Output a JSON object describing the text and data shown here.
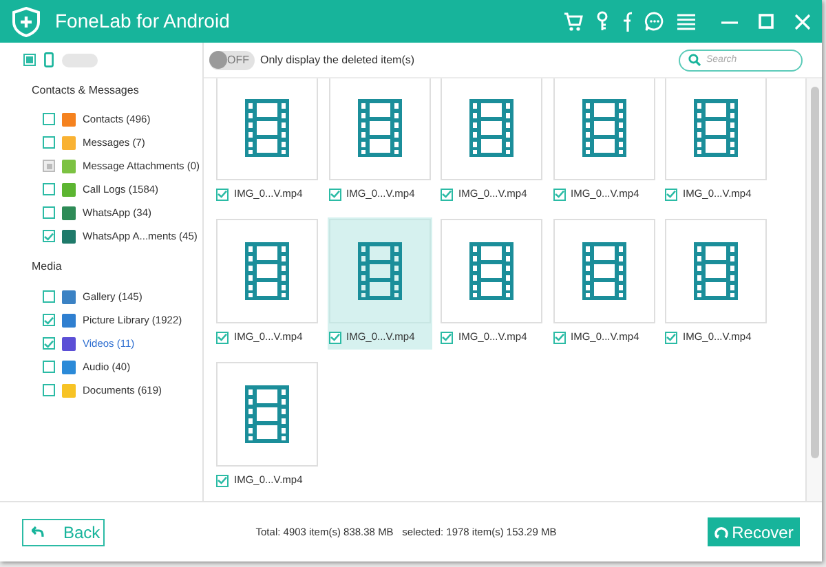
{
  "window": {
    "title": "FoneLab for Android"
  },
  "device": {
    "partially_checked": true
  },
  "filter": {
    "toggle_label": "OFF",
    "on": false,
    "label": "Only display the deleted item(s)"
  },
  "search": {
    "placeholder": "Search"
  },
  "sidebar": {
    "sections": [
      {
        "title": "Contacts & Messages",
        "items": [
          {
            "label": "Contacts (496)",
            "checked": false,
            "disabled": false,
            "selected": false,
            "color": "#f5821f"
          },
          {
            "label": "Messages (7)",
            "checked": false,
            "disabled": false,
            "selected": false,
            "color": "#f9b233"
          },
          {
            "label": "Message Attachments (0)",
            "checked": false,
            "disabled": true,
            "selected": false,
            "color": "#7cc242"
          },
          {
            "label": "Call Logs (1584)",
            "checked": false,
            "disabled": false,
            "selected": false,
            "color": "#5cb531"
          },
          {
            "label": "WhatsApp (34)",
            "checked": false,
            "disabled": false,
            "selected": false,
            "color": "#2e8b57"
          },
          {
            "label": "WhatsApp A...ments (45)",
            "checked": true,
            "disabled": false,
            "selected": false,
            "color": "#1f7a6a"
          }
        ]
      },
      {
        "title": "Media",
        "items": [
          {
            "label": "Gallery (145)",
            "checked": false,
            "disabled": false,
            "selected": false,
            "color": "#3b82c4"
          },
          {
            "label": "Picture Library (1922)",
            "checked": true,
            "disabled": false,
            "selected": false,
            "color": "#2f7fd0"
          },
          {
            "label": "Videos (11)",
            "checked": true,
            "disabled": false,
            "selected": true,
            "color": "#5b4fd6"
          },
          {
            "label": "Audio (40)",
            "checked": false,
            "disabled": false,
            "selected": false,
            "color": "#2b8ad8"
          },
          {
            "label": "Documents (619)",
            "checked": false,
            "disabled": false,
            "selected": false,
            "color": "#f7c325"
          }
        ]
      }
    ]
  },
  "files": [
    {
      "name": "IMG_0...V.mp4",
      "checked": true,
      "selected": false
    },
    {
      "name": "IMG_0...V.mp4",
      "checked": true,
      "selected": false
    },
    {
      "name": "IMG_0...V.mp4",
      "checked": true,
      "selected": false
    },
    {
      "name": "IMG_0...V.mp4",
      "checked": true,
      "selected": false
    },
    {
      "name": "IMG_0...V.mp4",
      "checked": true,
      "selected": false
    },
    {
      "name": "IMG_0...V.mp4",
      "checked": true,
      "selected": false
    },
    {
      "name": "IMG_0...V.mp4",
      "checked": true,
      "selected": true
    },
    {
      "name": "IMG_0...V.mp4",
      "checked": true,
      "selected": false
    },
    {
      "name": "IMG_0...V.mp4",
      "checked": true,
      "selected": false
    },
    {
      "name": "IMG_0...V.mp4",
      "checked": true,
      "selected": false
    },
    {
      "name": "IMG_0...V.mp4",
      "checked": true,
      "selected": false
    }
  ],
  "footer": {
    "back": "Back",
    "status": "Total: 4903 item(s) 838.38 MB   selected: 1978 item(s) 153.29 MB",
    "recover": "Recover"
  }
}
